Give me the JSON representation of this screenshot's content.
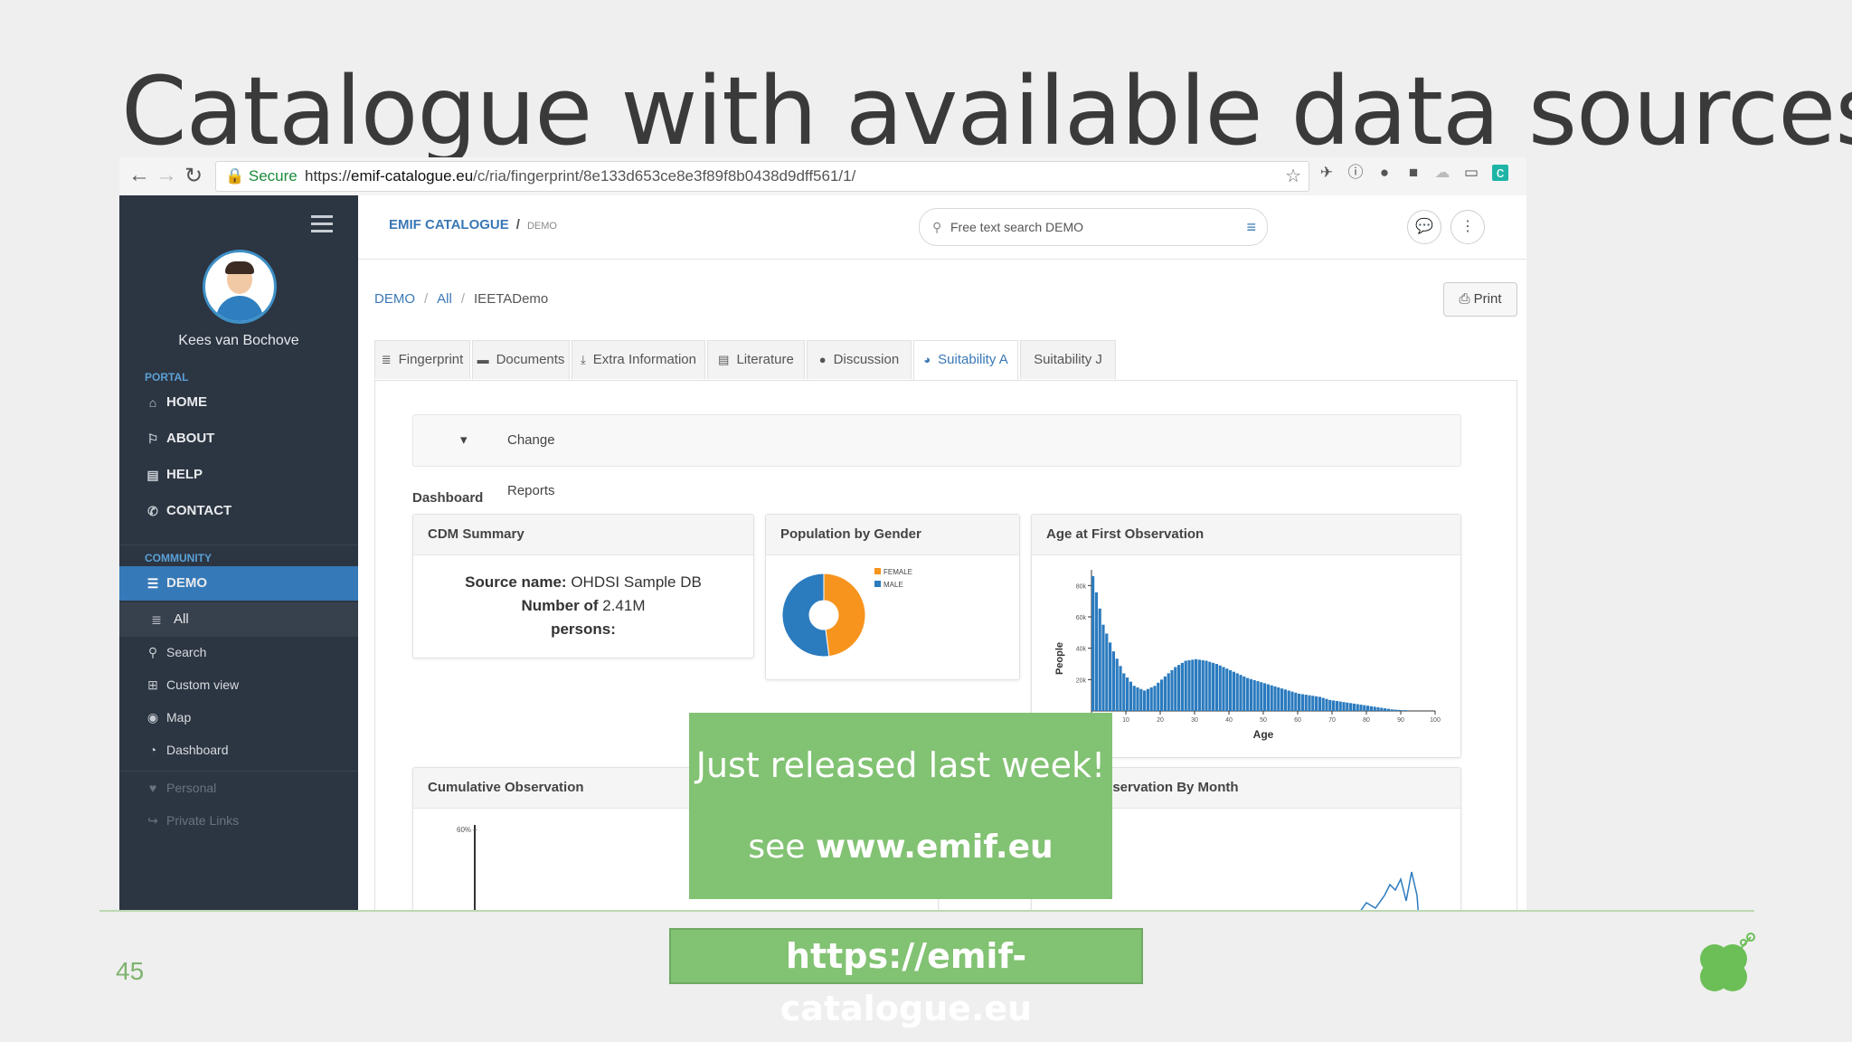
{
  "slide": {
    "title": "Catalogue with available data sources",
    "page_number": "45",
    "callout_line1": "Just released last week!",
    "callout_see": "see ",
    "callout_link": "www.emif.eu",
    "link_box": "https://emif-catalogue.eu"
  },
  "browser": {
    "secure_label": "Secure",
    "url_scheme": "https://",
    "url_host": "emif-catalogue.eu",
    "url_path": "/c/ria/fingerprint/8e133d653ce8e3f89f8b0438d9dff561/1/"
  },
  "sidebar": {
    "user_name": "Kees van Bochove",
    "portal_label": "PORTAL",
    "community_label": "COMMUNITY",
    "portal_items": [
      {
        "label": "HOME",
        "icon": "home-icon"
      },
      {
        "label": "ABOUT",
        "icon": "bookmark-icon"
      },
      {
        "label": "HELP",
        "icon": "book-icon"
      },
      {
        "label": "CONTACT",
        "icon": "phone-icon"
      }
    ],
    "community_items": [
      {
        "label": "DEMO",
        "icon": "database-icon"
      },
      {
        "label": "All",
        "icon": "list-icon"
      },
      {
        "label": "Search",
        "icon": "search-icon"
      },
      {
        "label": "Custom view",
        "icon": "grid-icon"
      },
      {
        "label": "Map",
        "icon": "globe-icon"
      },
      {
        "label": "Dashboard",
        "icon": "dashboard-icon"
      },
      {
        "label": "Personal",
        "icon": "heart-icon"
      },
      {
        "label": "Private Links",
        "icon": "share-icon"
      }
    ]
  },
  "header": {
    "brand": "EMIF CATALOGUE",
    "brand_sep": "/",
    "brand_sub": "DEMO",
    "search_placeholder": "Free text search DEMO"
  },
  "breadcrumb": [
    "DEMO",
    "All",
    "IEETADemo"
  ],
  "print_label": "Print",
  "tabs": [
    "Fingerprint",
    "Documents",
    "Extra Information",
    "Literature",
    "Discussion",
    "Suitability A",
    "Suitability J"
  ],
  "change_reports": "Change Reports",
  "dashboard": {
    "label": "Dashboard",
    "cdm_title": "CDM Summary",
    "cdm_source_label": "Source name:",
    "cdm_source_value": "OHDSI Sample DB",
    "cdm_persons_label": "Number of",
    "cdm_persons_value": "2.41M",
    "cdm_persons_label2": "persons:",
    "gender_title": "Population by Gender",
    "age_title": "Age at First Observation",
    "cumulative_title": "Cumulative Observation",
    "monthly_title": "...uous Observation By Month"
  },
  "chart_data": [
    {
      "type": "pie",
      "title": "Population by Gender",
      "categories": [
        "FEMALE",
        "MALE"
      ],
      "values": [
        48,
        52
      ],
      "colors": [
        "#f7941d",
        "#2b7bbf"
      ]
    },
    {
      "type": "bar",
      "title": "Age at First Observation",
      "xlabel": "Age",
      "ylabel": "People",
      "x_ticks": [
        "0",
        "10",
        "20",
        "30",
        "40",
        "50",
        "60",
        "70",
        "80",
        "90",
        "100"
      ],
      "y_ticks": [
        "20k",
        "40k",
        "60k",
        "80k"
      ],
      "xlim": [
        0,
        100
      ],
      "ylim": [
        0,
        90
      ],
      "color": "#2b7bbf",
      "x": [
        0,
        3,
        6,
        9,
        12,
        15,
        18,
        21,
        24,
        27,
        30,
        33,
        36,
        39,
        42,
        45,
        48,
        51,
        54,
        57,
        60,
        63,
        66,
        69,
        72,
        75,
        78,
        81,
        84,
        87,
        90
      ],
      "values": [
        86,
        55,
        38,
        24,
        16,
        13,
        16,
        22,
        28,
        32,
        33,
        32,
        30,
        27,
        24,
        21,
        19,
        17,
        15,
        13,
        11,
        10,
        9,
        7,
        6,
        5,
        4,
        3,
        2,
        1,
        0.5
      ]
    }
  ],
  "colors": {
    "accent": "#3a78b5",
    "sidebar_bg": "#2c3542",
    "callout": "#82c273"
  }
}
